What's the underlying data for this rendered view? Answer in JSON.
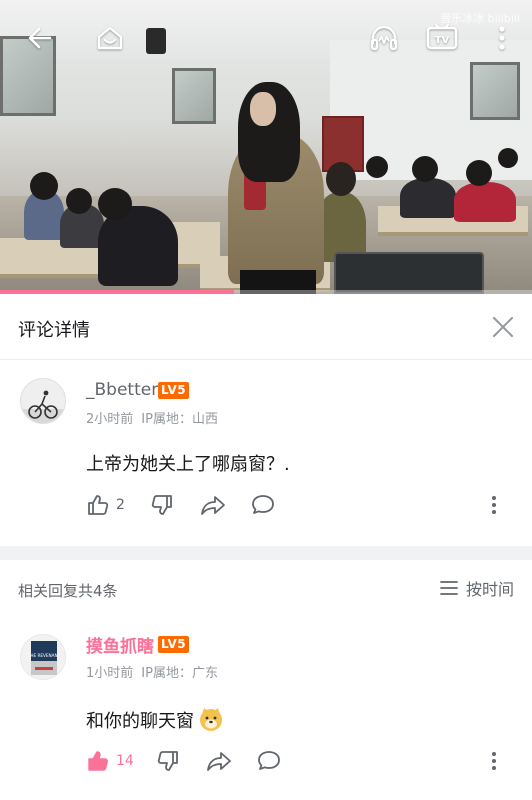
{
  "video": {
    "watermark": "音乐冰冰 bilibili",
    "progress_fraction": 0.44,
    "icons": {
      "back": "arrow-left-icon",
      "home": "home-icon",
      "listen": "headphones-icon",
      "cast": "tv-cast-icon",
      "more": "more-vertical-icon"
    }
  },
  "sheet": {
    "title": "评论详情"
  },
  "main_comment": {
    "username": "_Bbetter",
    "level": "LV5",
    "time": "2小时前",
    "ip": "IP属地：山西",
    "text": "上帝为她关上了哪扇窗？.",
    "like_count": "2",
    "username_color": "#61666d"
  },
  "replies": {
    "title": "相关回复共4条",
    "sort_label": "按时间"
  },
  "reply_1": {
    "username": "摸鱼抓瞎",
    "level": "LV5",
    "time": "1小时前",
    "ip": "IP属地：广东",
    "text": "和你的聊天窗",
    "like_count": "14",
    "username_color": "#fb7299",
    "avatar_caption": "THE REVENANT"
  },
  "colors": {
    "accent": "#fb7299",
    "level_badge": "#ff6a00",
    "text_primary": "#18191c",
    "text_secondary": "#9499a0"
  }
}
